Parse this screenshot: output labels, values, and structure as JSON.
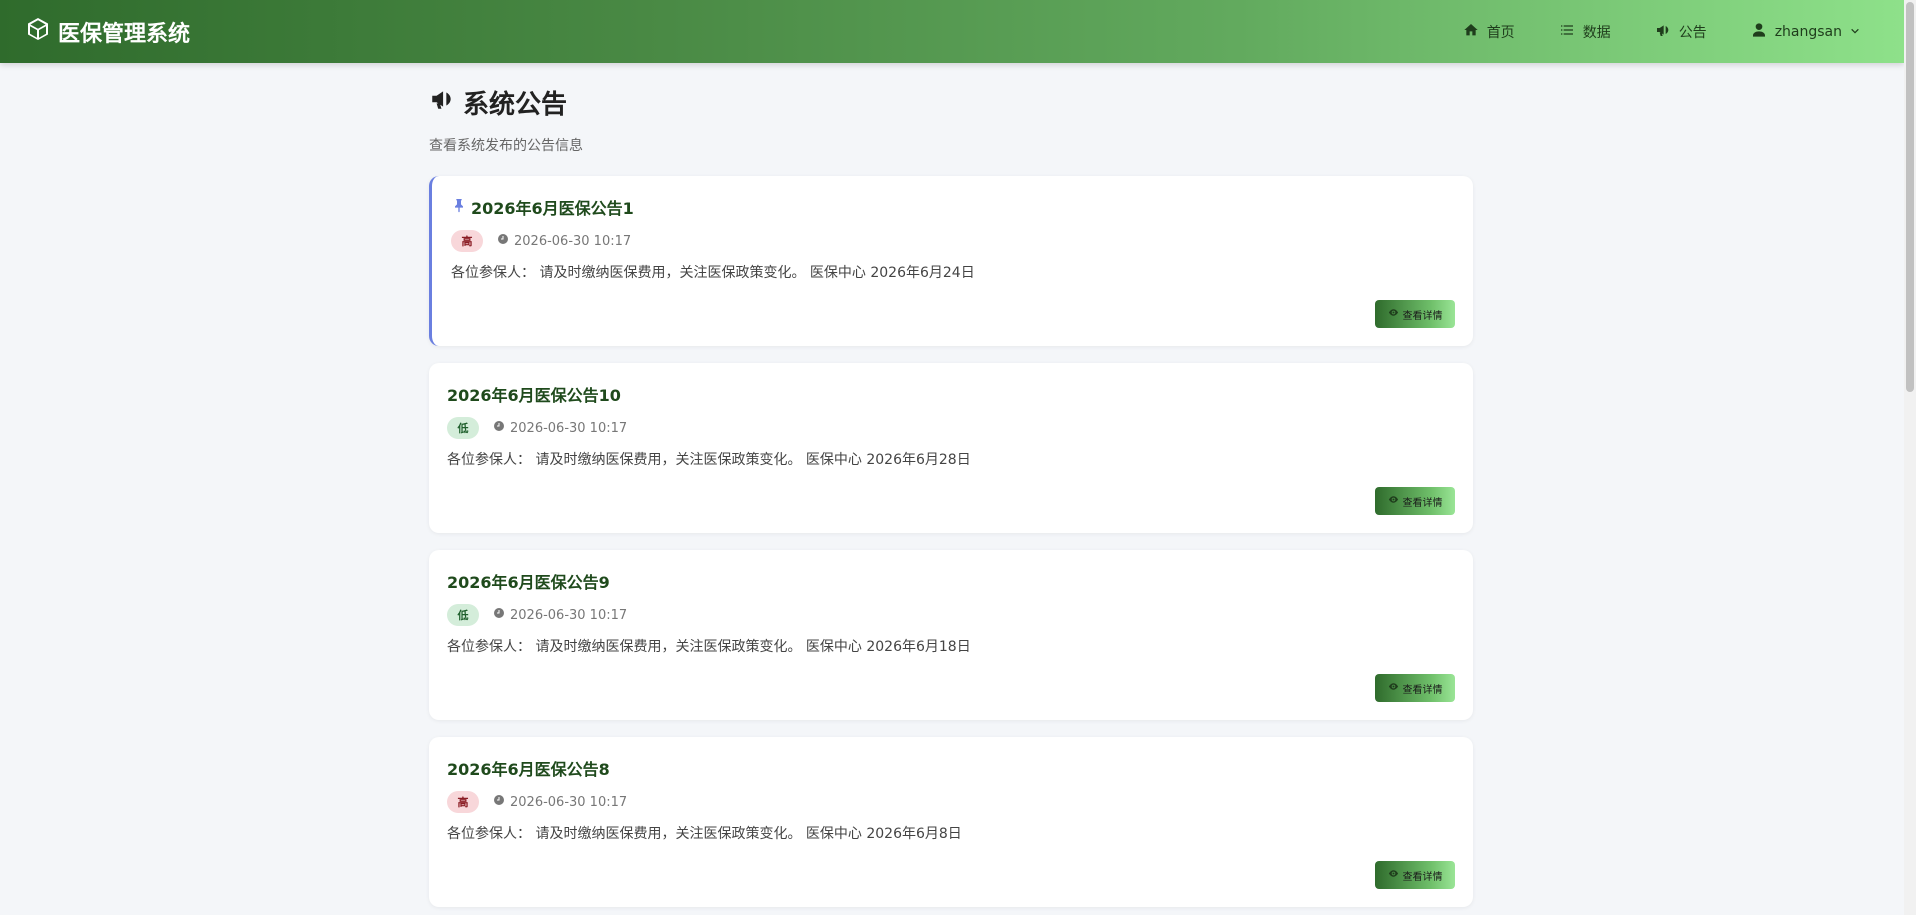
{
  "app": {
    "title": "医保管理系统",
    "logo_icon": "cube-icon"
  },
  "nav": {
    "items": [
      {
        "label": "首页",
        "icon": "home-icon"
      },
      {
        "label": "数据",
        "icon": "list-icon"
      },
      {
        "label": "公告",
        "icon": "megaphone-icon"
      }
    ],
    "user": {
      "name": "zhangsan",
      "icon": "user-icon"
    }
  },
  "page": {
    "title": "系统公告",
    "subtitle": "查看系统发布的公告信息"
  },
  "announcements": [
    {
      "title": "2026年6月医保公告1",
      "pinned": true,
      "priority": "高",
      "priority_level": "high",
      "time": "2026-06-30 10:17",
      "content": "各位参保人： 请及时缴纳医保费用，关注医保政策变化。 医保中心 2026年6月24日",
      "button_label": "查看详情"
    },
    {
      "title": "2026年6月医保公告10",
      "pinned": false,
      "priority": "低",
      "priority_level": "low",
      "time": "2026-06-30 10:17",
      "content": "各位参保人： 请及时缴纳医保费用，关注医保政策变化。 医保中心 2026年6月28日",
      "button_label": "查看详情"
    },
    {
      "title": "2026年6月医保公告9",
      "pinned": false,
      "priority": "低",
      "priority_level": "low",
      "time": "2026-06-30 10:17",
      "content": "各位参保人： 请及时缴纳医保费用，关注医保政策变化。 医保中心 2026年6月18日",
      "button_label": "查看详情"
    },
    {
      "title": "2026年6月医保公告8",
      "pinned": false,
      "priority": "高",
      "priority_level": "high",
      "time": "2026-06-30 10:17",
      "content": "各位参保人： 请及时缴纳医保费用，关注医保政策变化。 医保中心 2026年6月8日",
      "button_label": "查看详情"
    }
  ]
}
